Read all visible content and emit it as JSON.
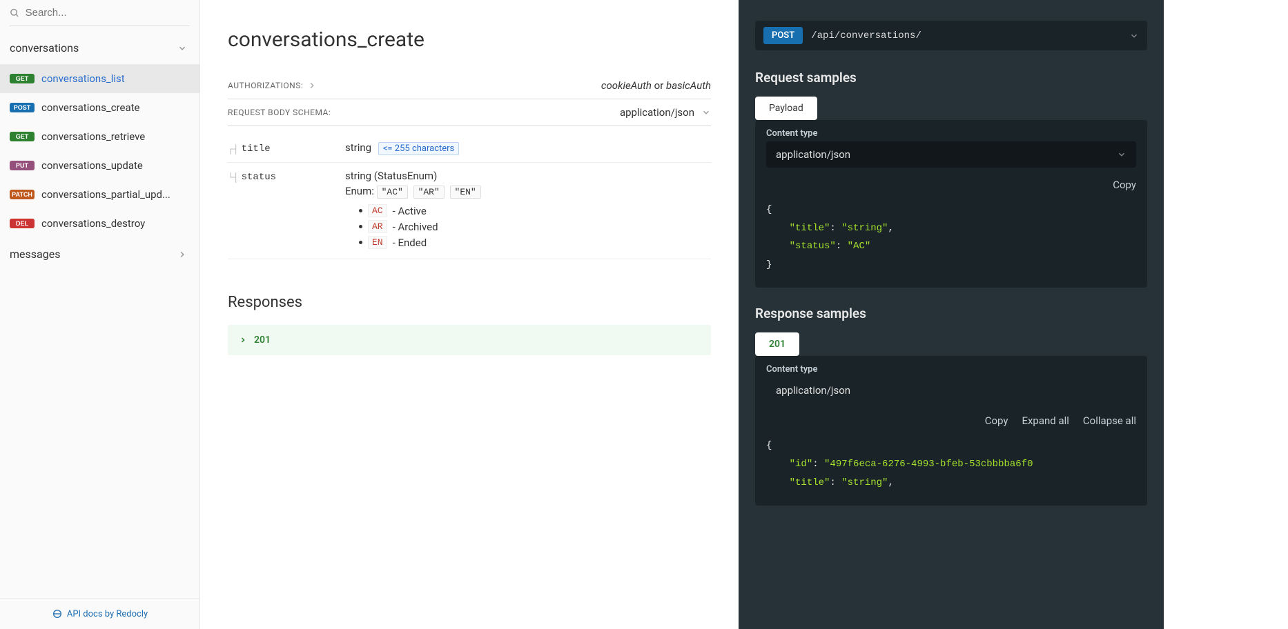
{
  "search": {
    "placeholder": "Search..."
  },
  "sidebar": {
    "groups": [
      {
        "label": "conversations"
      },
      {
        "label": "messages"
      }
    ],
    "items": [
      {
        "method": "GET",
        "label": "conversations_list",
        "active": true
      },
      {
        "method": "POST",
        "label": "conversations_create"
      },
      {
        "method": "GET",
        "label": "conversations_retrieve"
      },
      {
        "method": "PUT",
        "label": "conversations_update"
      },
      {
        "method": "PATCH",
        "label": "conversations_partial_upd..."
      },
      {
        "method": "DEL",
        "label": "conversations_destroy"
      }
    ],
    "footer": "API docs by Redocly"
  },
  "main": {
    "title": "conversations_create",
    "auth_label": "AUTHORIZATIONS:",
    "auth_cookie": "cookieAuth",
    "auth_or": " or ",
    "auth_basic": "basicAuth",
    "body_label": "REQUEST BODY SCHEMA:",
    "body_ct": "application/json",
    "fields": {
      "title": {
        "name": "title",
        "type": "string",
        "constraint": "<= 255 characters"
      },
      "status": {
        "name": "status",
        "type": "string (StatusEnum)",
        "enum_label": "Enum:",
        "enums": [
          "\"AC\"",
          "\"AR\"",
          "\"EN\""
        ],
        "descriptions": [
          {
            "code": "AC",
            "text": "- Active"
          },
          {
            "code": "AR",
            "text": "- Archived"
          },
          {
            "code": "EN",
            "text": "- Ended"
          }
        ]
      }
    },
    "responses_heading": "Responses",
    "response_code": "201"
  },
  "right": {
    "method": "POST",
    "path": "/api/conversations/",
    "req_heading": "Request samples",
    "payload_tab": "Payload",
    "ct_label": "Content type",
    "ct_value": "application/json",
    "copy": "Copy",
    "expand": "Expand all",
    "collapse": "Collapse all",
    "req_json": {
      "open": "{",
      "l1_key": "\"title\"",
      "l1_sep": ": ",
      "l1_val": "\"string\"",
      "l1_c": ",",
      "l2_key": "\"status\"",
      "l2_sep": ": ",
      "l2_val": "\"AC\"",
      "close": "}"
    },
    "resp_heading": "Response samples",
    "resp_tab": "201",
    "resp_json": {
      "open": "{",
      "l1_key": "\"id\"",
      "l1_sep": ": ",
      "l1_val": "\"497f6eca-6276-4993-bfeb-53cbbbba6f0",
      "l2_key": "\"title\"",
      "l2_sep": ": ",
      "l2_val": "\"string\"",
      "l2_c": ","
    }
  }
}
